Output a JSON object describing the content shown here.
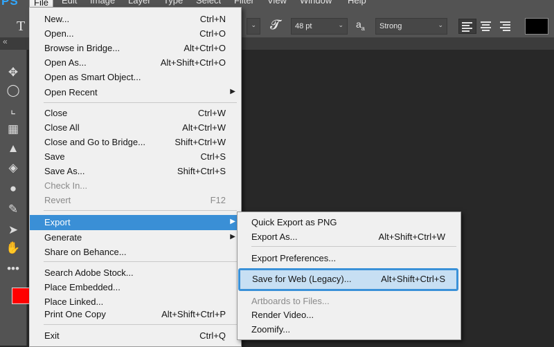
{
  "app": {
    "logo": "PS"
  },
  "menubar": [
    "File",
    "Edit",
    "Image",
    "Layer",
    "Type",
    "Select",
    "Filter",
    "View",
    "Window",
    "Help"
  ],
  "options": {
    "tool_glyph": "T",
    "size_value": "48 pt",
    "aa_glyph": "a",
    "antialias_value": "Strong",
    "text_color": "#000000"
  },
  "colors": {
    "foreground": "#ff0000",
    "highlight": "#3a8fd6"
  },
  "tools": [
    "move-icon",
    "lasso-icon",
    "crop-icon",
    "healing-brush-icon",
    "clone-stamp-icon",
    "eraser-icon",
    "blur-drop-icon",
    "pen-icon",
    "path-selection-icon",
    "hand-icon",
    "more-tools-icon"
  ],
  "file_menu": {
    "new": {
      "label": "New...",
      "shortcut": "Ctrl+N"
    },
    "open": {
      "label": "Open...",
      "shortcut": "Ctrl+O"
    },
    "browse_bridge": {
      "label": "Browse in Bridge...",
      "shortcut": "Alt+Ctrl+O"
    },
    "open_as": {
      "label": "Open As...",
      "shortcut": "Alt+Shift+Ctrl+O"
    },
    "open_smart": {
      "label": "Open as Smart Object..."
    },
    "open_recent": {
      "label": "Open Recent"
    },
    "close": {
      "label": "Close",
      "shortcut": "Ctrl+W"
    },
    "close_all": {
      "label": "Close All",
      "shortcut": "Alt+Ctrl+W"
    },
    "close_bridge": {
      "label": "Close and Go to Bridge...",
      "shortcut": "Shift+Ctrl+W"
    },
    "save": {
      "label": "Save",
      "shortcut": "Ctrl+S"
    },
    "save_as": {
      "label": "Save As...",
      "shortcut": "Shift+Ctrl+S"
    },
    "check_in": {
      "label": "Check In..."
    },
    "revert": {
      "label": "Revert",
      "shortcut": "F12"
    },
    "export": {
      "label": "Export"
    },
    "generate": {
      "label": "Generate"
    },
    "share_behance": {
      "label": "Share on Behance..."
    },
    "search_stock": {
      "label": "Search Adobe Stock..."
    },
    "place_embedded": {
      "label": "Place Embedded..."
    },
    "place_linked": {
      "label": "Place Linked..."
    },
    "print_one": {
      "label": "Print One Copy",
      "shortcut": "Alt+Shift+Ctrl+P"
    },
    "exit": {
      "label": "Exit",
      "shortcut": "Ctrl+Q"
    }
  },
  "export_menu": {
    "quick_png": {
      "label": "Quick Export as PNG"
    },
    "export_as": {
      "label": "Export As...",
      "shortcut": "Alt+Shift+Ctrl+W"
    },
    "preferences": {
      "label": "Export Preferences..."
    },
    "save_web": {
      "label": "Save for Web (Legacy)...",
      "shortcut": "Alt+Shift+Ctrl+S"
    },
    "artboards": {
      "label": "Artboards to Files..."
    },
    "render_video": {
      "label": "Render Video..."
    },
    "zoomify": {
      "label": "Zoomify..."
    }
  }
}
